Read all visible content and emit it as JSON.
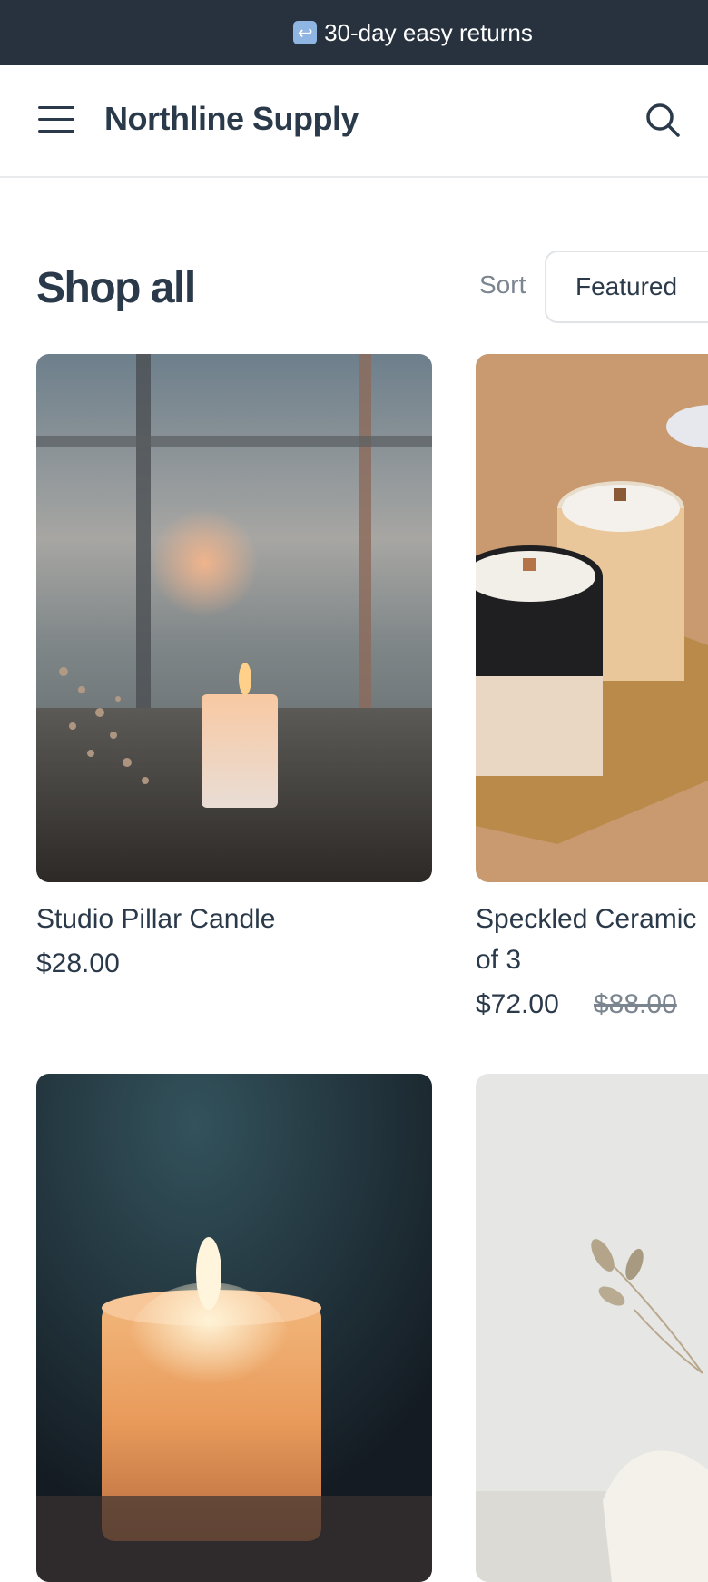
{
  "announcement": {
    "icon": "return-arrow-icon",
    "text": "30-day easy returns"
  },
  "header": {
    "brand": "Northline Supply",
    "menu_icon": "hamburger-menu-icon",
    "search_icon": "search-icon"
  },
  "collection": {
    "title": "Shop all",
    "sort_label": "Sort",
    "sort_value": "Featured"
  },
  "products": [
    {
      "name": "Studio Pillar Candle",
      "price": "$28.00",
      "compare_price": ""
    },
    {
      "name_line1": "Speckled Ceramic",
      "name_line2": "of 3",
      "price": "$72.00",
      "compare_price": "$88.00"
    },
    {
      "name": "",
      "price": ""
    },
    {
      "name": "",
      "price": ""
    }
  ],
  "colors": {
    "announcement_bg": "#27323e",
    "text": "#2b3a4a",
    "muted": "#7b858f"
  }
}
